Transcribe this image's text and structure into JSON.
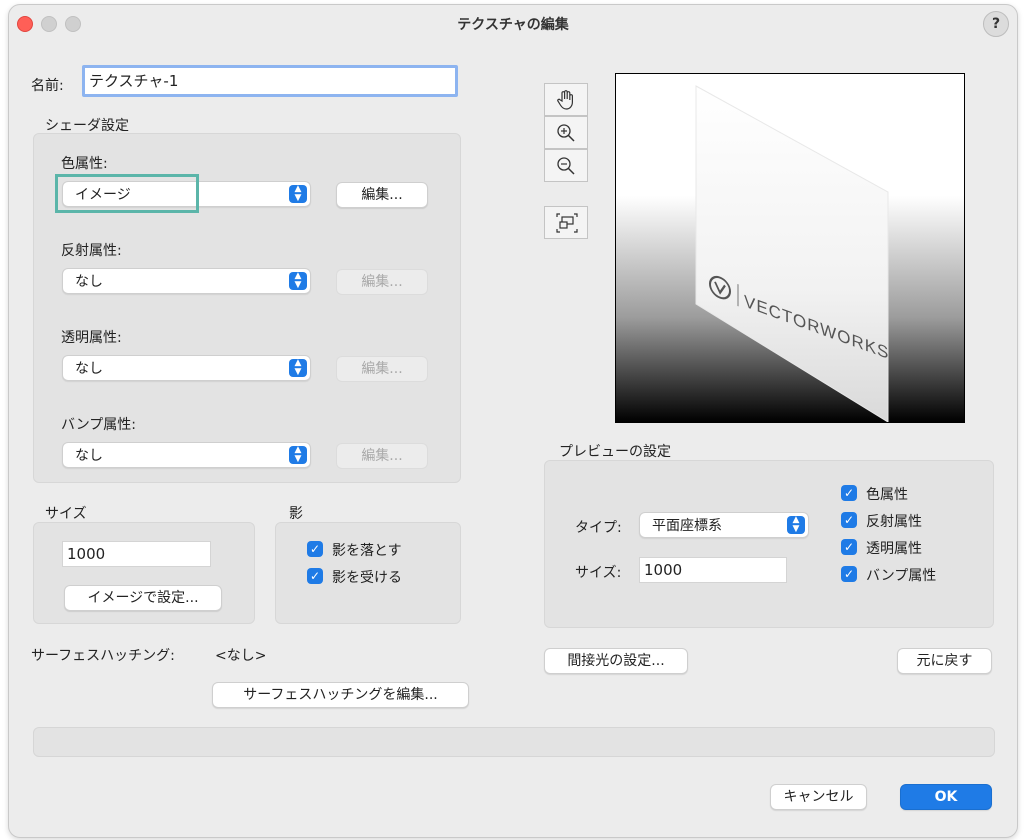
{
  "window": {
    "title": "テクスチャの編集",
    "help_label": "?"
  },
  "name": {
    "label": "名前:",
    "value": "テクスチャ-1"
  },
  "shader": {
    "heading": "シェーダ設定",
    "color": {
      "label": "色属性:",
      "value": "イメージ",
      "edit_label": "編集..."
    },
    "reflectivity": {
      "label": "反射属性:",
      "value": "なし",
      "edit_label": "編集..."
    },
    "transparency": {
      "label": "透明属性:",
      "value": "なし",
      "edit_label": "編集..."
    },
    "bump": {
      "label": "バンプ属性:",
      "value": "なし",
      "edit_label": "編集..."
    }
  },
  "size": {
    "heading": "サイズ",
    "value": "1000",
    "image_button": "イメージで設定..."
  },
  "shadow": {
    "heading": "影",
    "cast": "影を落とす",
    "receive": "影を受ける"
  },
  "hatch": {
    "label": "サーフェスハッチング:",
    "value": "<なし>",
    "edit_button": "サーフェスハッチングを編集..."
  },
  "preview": {
    "heading": "プレビューの設定",
    "type_label": "タイプ:",
    "type_value": "平面座標系",
    "size_label": "サイズ:",
    "size_value": "1000",
    "checks": [
      "色属性",
      "反射属性",
      "透明属性",
      "バンプ属性"
    ],
    "indirect_button": "間接光の設定...",
    "revert_button": "元に戻す",
    "logo_text": "VECTORWORKS"
  },
  "footer": {
    "cancel": "キャンセル",
    "ok": "OK"
  },
  "colors": {
    "accent": "#1f7be6",
    "highlight": "#5bb5a9",
    "close": "#ff5f57"
  },
  "icons": [
    "hand-icon",
    "zoom-in-icon",
    "zoom-out-icon",
    "fit-view-icon",
    "checkmark-icon",
    "stepper-icon"
  ]
}
